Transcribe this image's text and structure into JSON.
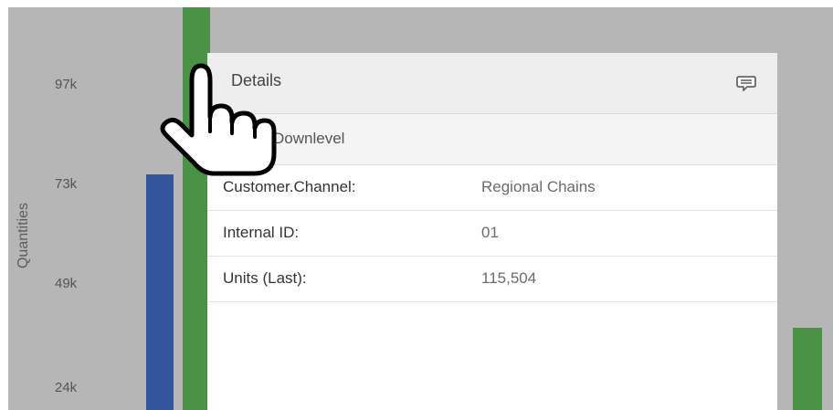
{
  "chart": {
    "y_title": "Quantities",
    "y_ticks": [
      "97k",
      "73k",
      "49k",
      "24k"
    ],
    "colors": {
      "blue": "#35559b",
      "green": "#4a9246",
      "background": "#b6b6b6"
    }
  },
  "details": {
    "title": "Details",
    "header_icon": "comment-icon",
    "subtitle": "Downlevel",
    "rows": [
      {
        "key": "Customer.Channel:",
        "value": "Regional Chains"
      },
      {
        "key": "Internal ID:",
        "value": "01"
      },
      {
        "key": "Units (Last):",
        "value": "115,504"
      }
    ]
  },
  "cursor": {
    "icon": "hand-pointer-icon"
  }
}
